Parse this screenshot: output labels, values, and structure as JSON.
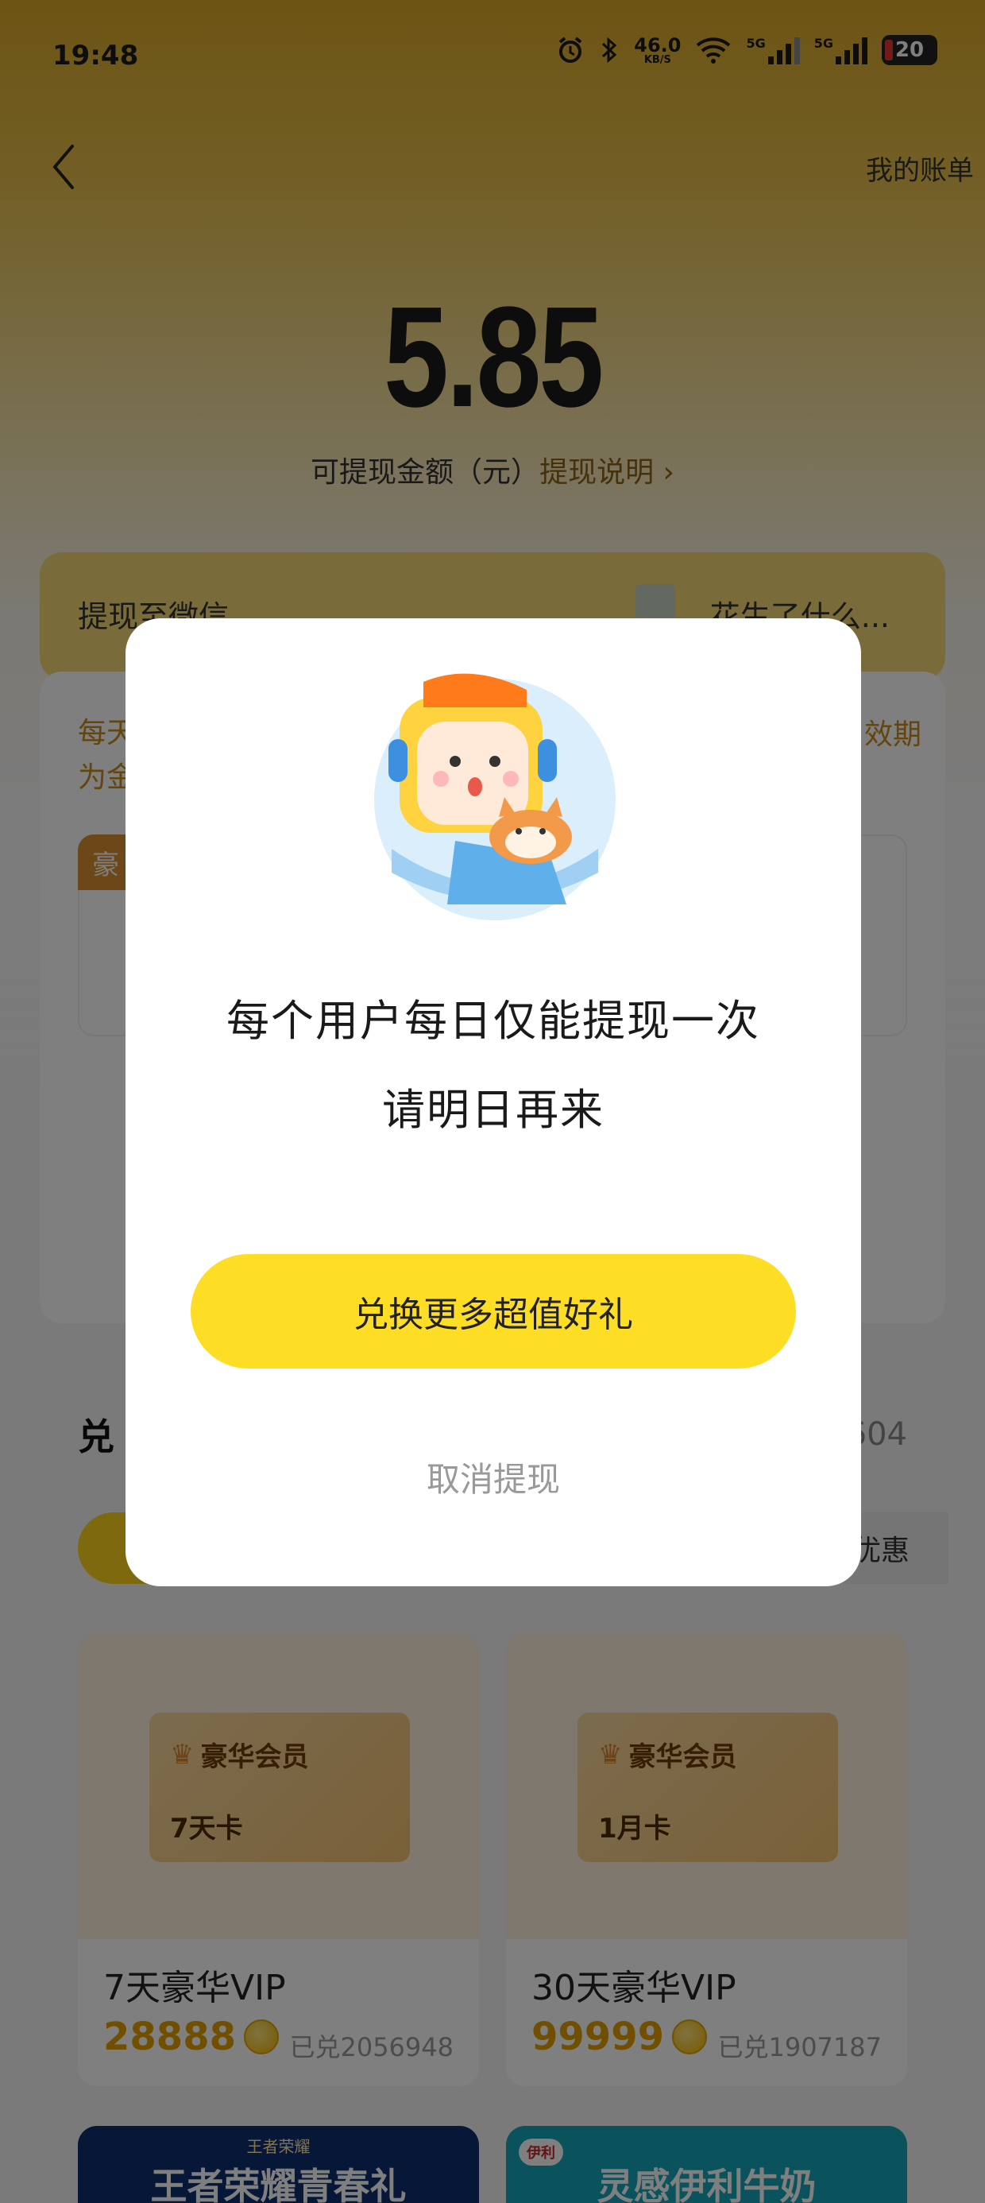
{
  "status_bar": {
    "time": "19:48",
    "net_speed": "46.0",
    "net_unit": "KB/S",
    "sim1": "5G",
    "sim2": "5G",
    "battery": "20"
  },
  "header": {
    "bill_link": "我的账单"
  },
  "balance": {
    "amount": "5.85",
    "label": "可提现金额（元）",
    "help_link": "提现说明"
  },
  "withdraw_card": {
    "title": "提现至微信",
    "account_name": "花生了什么..."
  },
  "info_card": {
    "desc_left": "每天\n为金",
    "desc_right": "效期",
    "tag": "豪"
  },
  "exchange_section": {
    "title_partial": "兑",
    "right_partial": "604",
    "chip_right": "优惠"
  },
  "products": [
    {
      "brand": "豪华会员",
      "term": "7天卡",
      "name": "7天豪华VIP",
      "price": "28888",
      "sold": "已兑2056948"
    },
    {
      "brand": "豪华会员",
      "term": "1月卡",
      "name": "30天豪华VIP",
      "price": "99999",
      "sold": "已兑1907187"
    }
  ],
  "promos": [
    {
      "small": "王者荣耀",
      "text": "王者荣耀青春礼",
      "bg": "#0f2f6e"
    },
    {
      "logo": "伊利",
      "text": "灵感伊利牛奶",
      "bg": "#15a6b8"
    }
  ],
  "dialog": {
    "message_line1": "每个用户每日仅能提现一次",
    "message_line2": "请明日再来",
    "primary_button": "兑换更多超值好礼",
    "cancel_button": "取消提现"
  },
  "colors": {
    "accent_yellow": "#fedd25",
    "gold_text": "#c68a1a",
    "price": "#e0a000"
  }
}
